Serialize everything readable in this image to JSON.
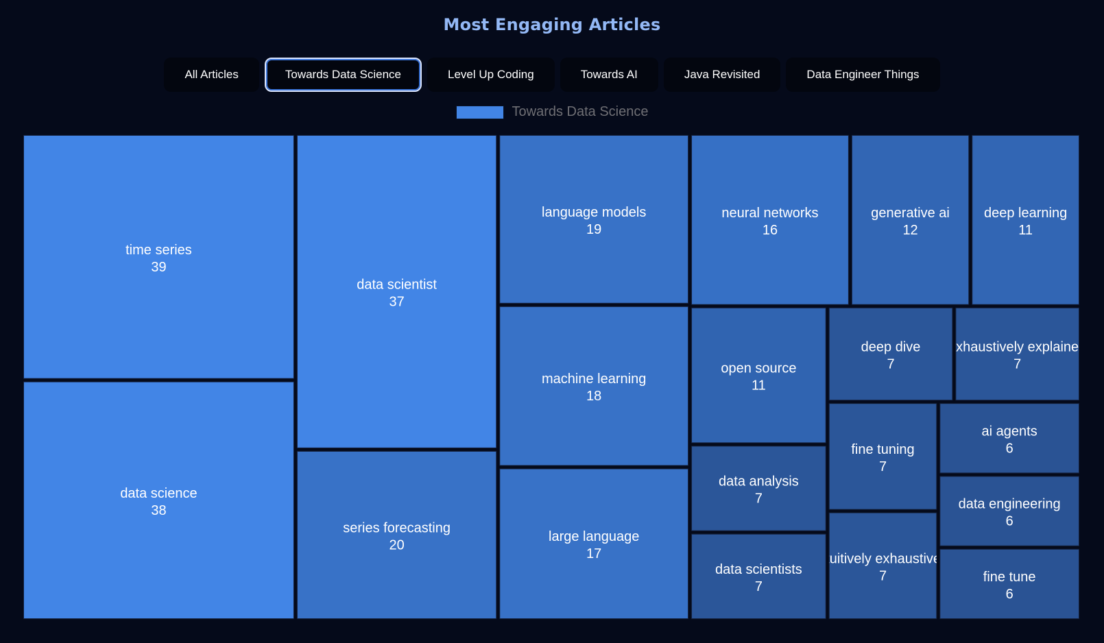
{
  "title": "Most Engaging Articles",
  "tabs": [
    {
      "label": "All Articles",
      "active": false
    },
    {
      "label": "Towards Data Science",
      "active": true
    },
    {
      "label": "Level Up Coding",
      "active": false
    },
    {
      "label": "Towards AI",
      "active": false
    },
    {
      "label": "Java Revisited",
      "active": false
    },
    {
      "label": "Data Engineer Things",
      "active": false
    }
  ],
  "legend": {
    "label": "Towards Data Science",
    "color": "#4285e6"
  },
  "chart_data": {
    "type": "treemap",
    "title": "Most Engaging Articles",
    "series_name": "Towards Data Science",
    "legend_position": "top-center",
    "items": [
      {
        "label": "time series",
        "value": 39,
        "color": "#4285e6"
      },
      {
        "label": "data science",
        "value": 38,
        "color": "#4285e6"
      },
      {
        "label": "data scientist",
        "value": 37,
        "color": "#4285e6"
      },
      {
        "label": "series forecasting",
        "value": 20,
        "color": "#3872c7"
      },
      {
        "label": "language models",
        "value": 19,
        "color": "#3872c7"
      },
      {
        "label": "machine learning",
        "value": 18,
        "color": "#3872c7"
      },
      {
        "label": "large language",
        "value": 17,
        "color": "#3872c7"
      },
      {
        "label": "neural networks",
        "value": 16,
        "color": "#3670c5"
      },
      {
        "label": "generative ai",
        "value": 12,
        "color": "#3266b4"
      },
      {
        "label": "deep learning",
        "value": 11,
        "color": "#3266b4"
      },
      {
        "label": "open source",
        "value": 11,
        "color": "#3064b1"
      },
      {
        "label": "data analysis",
        "value": 7,
        "color": "#2b5699"
      },
      {
        "label": "data scientists",
        "value": 7,
        "color": "#2b5699"
      },
      {
        "label": "deep dive",
        "value": 7,
        "color": "#2b5699"
      },
      {
        "label": "exhaustively explained",
        "value": 7,
        "color": "#2b5699"
      },
      {
        "label": "fine tuning",
        "value": 7,
        "color": "#2b5699"
      },
      {
        "label": "intuitively exhaustively",
        "value": 7,
        "color": "#2b5699"
      },
      {
        "label": "ai agents",
        "value": 6,
        "color": "#2a5394"
      },
      {
        "label": "data engineering",
        "value": 6,
        "color": "#2a5394"
      },
      {
        "label": "fine tune",
        "value": 6,
        "color": "#2a5394"
      }
    ]
  }
}
